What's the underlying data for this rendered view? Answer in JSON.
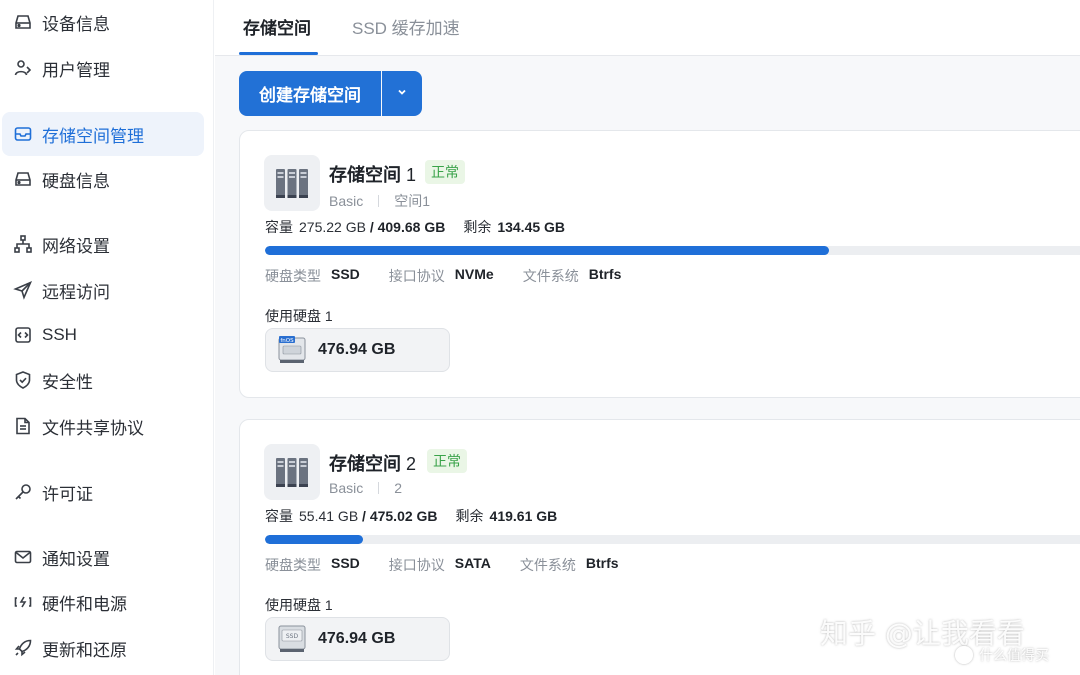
{
  "sidebar": {
    "items": [
      {
        "label": "设备信息",
        "icon": "device-icon",
        "active": false
      },
      {
        "label": "用户管理",
        "icon": "users-icon",
        "active": false
      },
      {
        "label": "存储空间管理",
        "icon": "storage-icon",
        "active": true
      },
      {
        "label": "硬盘信息",
        "icon": "harddisk-icon",
        "active": false
      },
      {
        "label": "网络设置",
        "icon": "network-icon",
        "active": false
      },
      {
        "label": "远程访问",
        "icon": "send-icon",
        "active": false
      },
      {
        "label": "SSH",
        "icon": "code-icon",
        "active": false
      },
      {
        "label": "安全性",
        "icon": "shield-icon",
        "active": false
      },
      {
        "label": "文件共享协议",
        "icon": "file-icon",
        "active": false
      },
      {
        "label": "许可证",
        "icon": "key-icon",
        "active": false
      },
      {
        "label": "通知设置",
        "icon": "mail-icon",
        "active": false
      },
      {
        "label": "硬件和电源",
        "icon": "battery-icon",
        "active": false
      },
      {
        "label": "更新和还原",
        "icon": "rocket-icon",
        "active": false
      }
    ]
  },
  "tabs": [
    {
      "label": "存储空间",
      "active": true
    },
    {
      "label": "SSD 缓存加速",
      "active": false
    }
  ],
  "toolbar": {
    "create_label": "创建存储空间"
  },
  "colors": {
    "accent": "#1f6fd8",
    "status_ok": "#3aa34a"
  },
  "spaces": [
    {
      "name": "存储空间",
      "number": "1",
      "status": "正常",
      "type": "Basic",
      "alias": "空间1",
      "capacity_label": "容量",
      "used": "275.22 GB",
      "total": "409.68 GB",
      "remaining_label": "剩余",
      "remaining": "134.45 GB",
      "usage_fraction": 0.672,
      "disk_type_label": "硬盘类型",
      "disk_type": "SSD",
      "interface_label": "接口协议",
      "interface": "NVMe",
      "fs_label": "文件系统",
      "fs": "Btrfs",
      "disks_label": "使用硬盘 1",
      "disk_icon": "nvme-ssd-icon",
      "disk_icon_text": "fnOS",
      "disk_size": "476.94 GB"
    },
    {
      "name": "存储空间",
      "number": "2",
      "status": "正常",
      "type": "Basic",
      "alias": "2",
      "capacity_label": "容量",
      "used": "55.41 GB",
      "total": "475.02 GB",
      "remaining_label": "剩余",
      "remaining": "419.61 GB",
      "usage_fraction": 0.117,
      "disk_type_label": "硬盘类型",
      "disk_type": "SSD",
      "interface_label": "接口协议",
      "interface": "SATA",
      "fs_label": "文件系统",
      "fs": "Btrfs",
      "disks_label": "使用硬盘 1",
      "disk_icon": "sata-ssd-icon",
      "disk_icon_text": "SSD",
      "disk_size": "476.94 GB"
    }
  ],
  "watermark": {
    "main": "知乎 @让我看看",
    "small": "什么值得买"
  }
}
